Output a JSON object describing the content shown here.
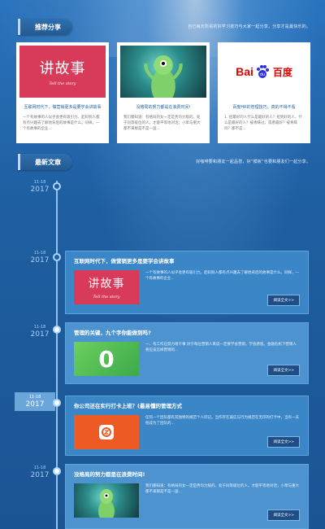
{
  "recommend": {
    "title": "推荐分享",
    "subtitle": "自己每天所看的好学习技巧与大家一起分享，分享才是最快乐的。",
    "cards": [
      {
        "thumb_icon": "storytelling-image",
        "thumb_big": "讲故事",
        "thumb_small": "Tell the story",
        "title": "互联网时代下，做营销更多是要学会讲故事",
        "desc": "一个有故事的人似乎会更有吸引力。起码别人都有点兴趣去了解他背后的故事是什么。同样，一个有故事的企业..."
      },
      {
        "thumb_icon": "alien-image",
        "title": "没格局的努力都是在浪费时间!",
        "desc": "我们都知道：有格局的女一定是势均力敌的。处于同等级位的人，才能平等地对话；小草与重大都不来那是不是一国..."
      },
      {
        "thumb_icon": "baidu-logo-image",
        "logo_bai": "Bai",
        "logo_du": "du",
        "logo_cn": "百度",
        "title": "百度HR的管理技巧，真的不得不看",
        "desc": "1. 招最好的人什么是最好的人？招到好的人，什么是最好的人？被青睐过，或者最好？被青睐吗？都不是..."
      }
    ]
  },
  "latest": {
    "title": "最新文章",
    "subtitle": "好咖啡要和朋友一起品尝，好“模板”也要和朋友们一起分享。",
    "empty_date": {
      "md": "11-18",
      "yr": "2017"
    },
    "articles": [
      {
        "date_md": "11-18",
        "date_yr": "2017",
        "title": "互联网时代下，做营销更多是要学会讲故事",
        "thumb_icon": "storytelling-image",
        "thumb_big": "讲故事",
        "thumb_small": "Tell the story",
        "text": "一个有故事的人似乎会更有吸引力。起码别人都有点兴趣去了解他背后的故事是什么。同样，一个有故事的企业...",
        "button": "阅读全文>>"
      },
      {
        "date_md": "11-18",
        "date_yr": "2017",
        "title": "管理的关键，九个字你能做到吗?",
        "thumb_icon": "zero-image",
        "thumb_text": "0",
        "text": "一、有工作应努力增干事 对于每位营销人来说一定要学会营销，学会感恩。金融危机下营销人要应该怎样营销的...",
        "button": "阅读全文>>"
      },
      {
        "date_md": "11-18",
        "date_yr": "2017",
        "title": "你公司还在实行打卡上班？(最易懂的管理方式",
        "thumb_icon": "clock-in-image",
        "text": "任何一个团队都有其独特的规范个人印记。当作存在诚信与行为规范在无印的打卡中，当有一天他成为了团队的...",
        "button": "阅读全文>>"
      },
      {
        "date_md": "11-18",
        "date_yr": "2017",
        "title": "没格局的努力都是在浪费时间!",
        "thumb_icon": "alien-image",
        "text": "我们都知道：有格局的女一定是势均力敌的。处于同等级位的人，才能平等地对话；小草与重大都不来那是不是一国...",
        "button": "阅读全文>>"
      }
    ]
  },
  "colors": {
    "background": "#1f5f9f",
    "article_bg": "#3b86c7",
    "accent_red": "#d83a5a",
    "button_bg": "#1f4e86"
  }
}
